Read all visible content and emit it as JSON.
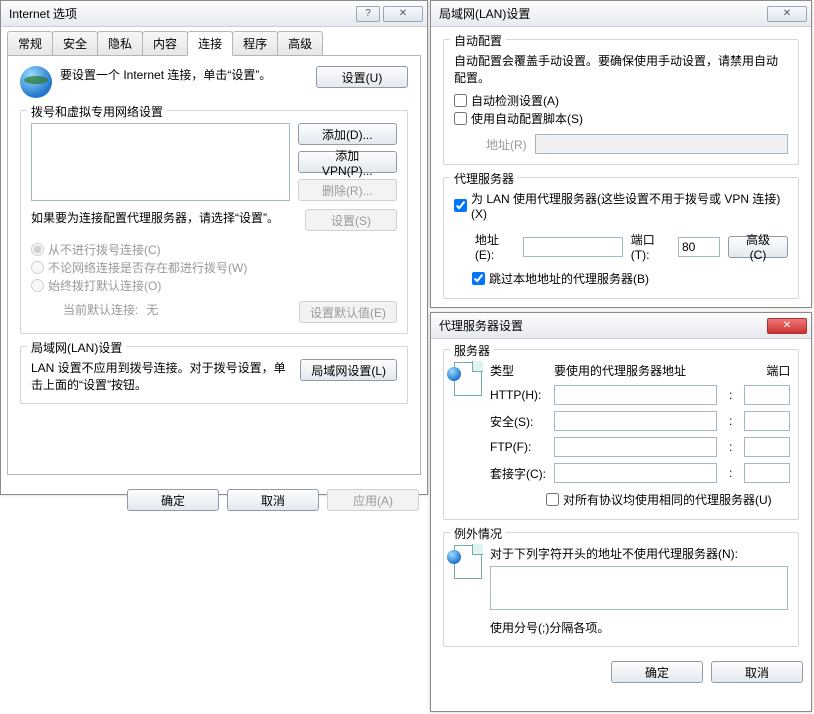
{
  "dlg1": {
    "title": "Internet 选项",
    "tabs": [
      "常规",
      "安全",
      "隐私",
      "内容",
      "连接",
      "程序",
      "高级"
    ],
    "active_tab": 4,
    "intro": "要设置一个 Internet 连接，单击“设置”。",
    "btn_setup": "设置(U)",
    "grp_dial": {
      "legend": "拨号和虚拟专用网络设置",
      "btn_add": "添加(D)...",
      "btn_add_vpn": "添加 VPN(P)...",
      "btn_remove": "删除(R)...",
      "hint": "如果要为连接配置代理服务器，请选择“设置”。",
      "btn_settings": "设置(S)",
      "radio1": "从不进行拨号连接(C)",
      "radio2": "不论网络连接是否存在都进行拨号(W)",
      "radio3": "始终拨打默认连接(O)",
      "default_label": "当前默认连接:",
      "default_value": "无",
      "btn_default": "设置默认值(E)"
    },
    "grp_lan": {
      "legend": "局域网(LAN)设置",
      "text": "LAN 设置不应用到拨号连接。对于拨号设置，单击上面的“设置”按钮。",
      "btn": "局域网设置(L)"
    },
    "btn_ok": "确定",
    "btn_cancel": "取消",
    "btn_apply": "应用(A)"
  },
  "dlg2": {
    "title": "局域网(LAN)设置",
    "grp_auto": {
      "legend": "自动配置",
      "text": "自动配置会覆盖手动设置。要确保使用手动设置，请禁用自动配置。",
      "chk_detect": "自动检测设置(A)",
      "chk_script": "使用自动配置脚本(S)",
      "addr_label": "地址(R)",
      "addr_value": ""
    },
    "grp_proxy": {
      "legend": "代理服务器",
      "chk_use": "为 LAN 使用代理服务器(这些设置不用于拨号或 VPN 连接)(X)",
      "addr_label": "地址(E):",
      "addr_value": "",
      "port_label": "端口(T):",
      "port_value": "80",
      "btn_adv": "高级(C)",
      "chk_bypass": "跳过本地地址的代理服务器(B)"
    },
    "btn_ok": "确定",
    "btn_cancel": "取消"
  },
  "dlg3": {
    "title": "代理服务器设置",
    "grp_srv": {
      "legend": "服务器",
      "col_type": "类型",
      "col_addr": "要使用的代理服务器地址",
      "col_port": "端口",
      "rows": [
        {
          "label": "HTTP(H):",
          "addr": "",
          "port": ""
        },
        {
          "label": "安全(S):",
          "addr": "",
          "port": ""
        },
        {
          "label": "FTP(F):",
          "addr": "",
          "port": ""
        },
        {
          "label": "套接字(C):",
          "addr": "",
          "port": ""
        }
      ],
      "chk_same": "对所有协议均使用相同的代理服务器(U)"
    },
    "grp_ex": {
      "legend": "例外情况",
      "text": "对于下列字符开头的地址不使用代理服务器(N):",
      "value": "",
      "hint": "使用分号(;)分隔各项。"
    },
    "btn_ok": "确定",
    "btn_cancel": "取消"
  }
}
